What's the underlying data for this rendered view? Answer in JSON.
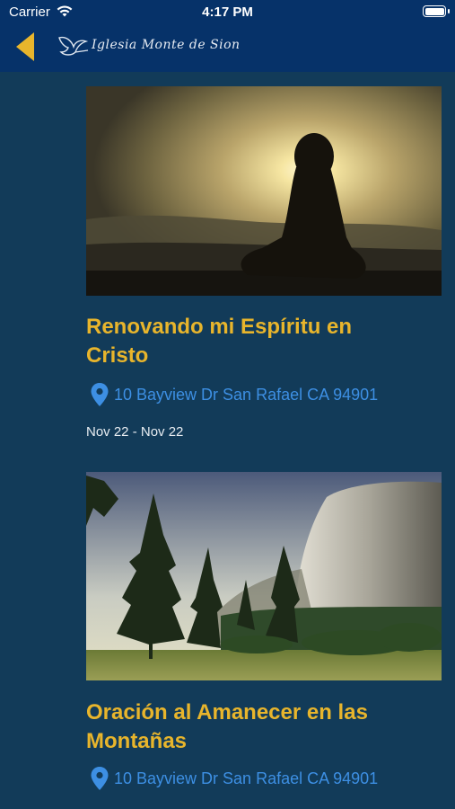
{
  "status_bar": {
    "carrier": "Carrier",
    "time": "4:17 PM"
  },
  "nav": {
    "brand": "Iglesia Monte de Sion",
    "back_icon": "chevron-left-icon",
    "logo_icon": "dove-logo-icon"
  },
  "colors": {
    "header": "#063269",
    "background": "#123b59",
    "title": "#e8b52c",
    "link": "#3d8fe3",
    "back_arrow": "#e8b52c"
  },
  "events": [
    {
      "title": "Renovando mi Espíritu en Cristo",
      "address": "10 Bayview Dr San Rafael CA 94901",
      "date": "Nov 22 - Nov 22",
      "image": "sunset-silhouette-meditation"
    },
    {
      "title": "Oración al Amanecer en las Montañas",
      "address": "10 Bayview Dr San Rafael CA 94901",
      "image": "forest-mountain-cliff"
    }
  ]
}
